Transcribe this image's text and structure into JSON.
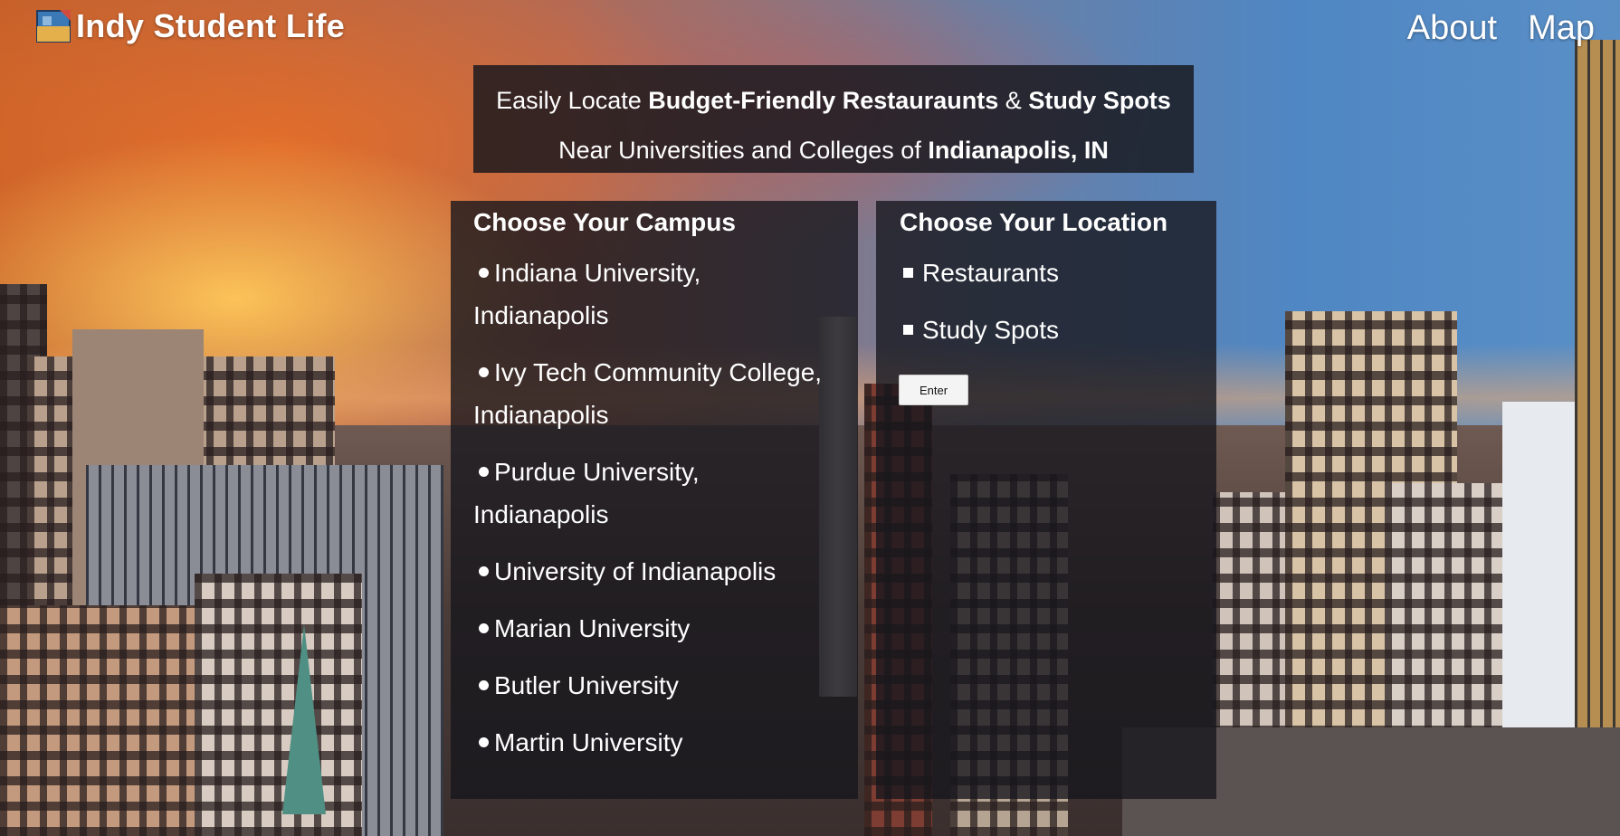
{
  "header": {
    "logo_text": "Indy Student Life",
    "nav": [
      {
        "label": "About"
      },
      {
        "label": "Map"
      }
    ]
  },
  "tagline": {
    "line1_prefix": "Easily Locate ",
    "line1_bold1": "Budget-Friendly Restauraunts",
    "line1_amp": " & ",
    "line1_bold2": "Study Spots",
    "line2_prefix": "Near Universities and Colleges of ",
    "line2_bold": "Indianapolis, IN"
  },
  "campus_panel": {
    "title": "Choose Your Campus",
    "items": [
      {
        "label": "Indiana University, Indianapolis"
      },
      {
        "label": "Ivy Tech Community College, Indianapolis"
      },
      {
        "label": "Purdue University, Indianapolis"
      },
      {
        "label": "University of Indianapolis"
      },
      {
        "label": "Marian University"
      },
      {
        "label": "Butler University"
      },
      {
        "label": "Martin University"
      }
    ]
  },
  "location_panel": {
    "title": "Choose Your Location",
    "items": [
      {
        "label": "Restaurants"
      },
      {
        "label": "Study Spots"
      }
    ],
    "enter_label": "Enter"
  },
  "colors": {
    "panel_bg": "#16161c",
    "text": "#ffffff",
    "button_bg": "#f4f4f4"
  }
}
